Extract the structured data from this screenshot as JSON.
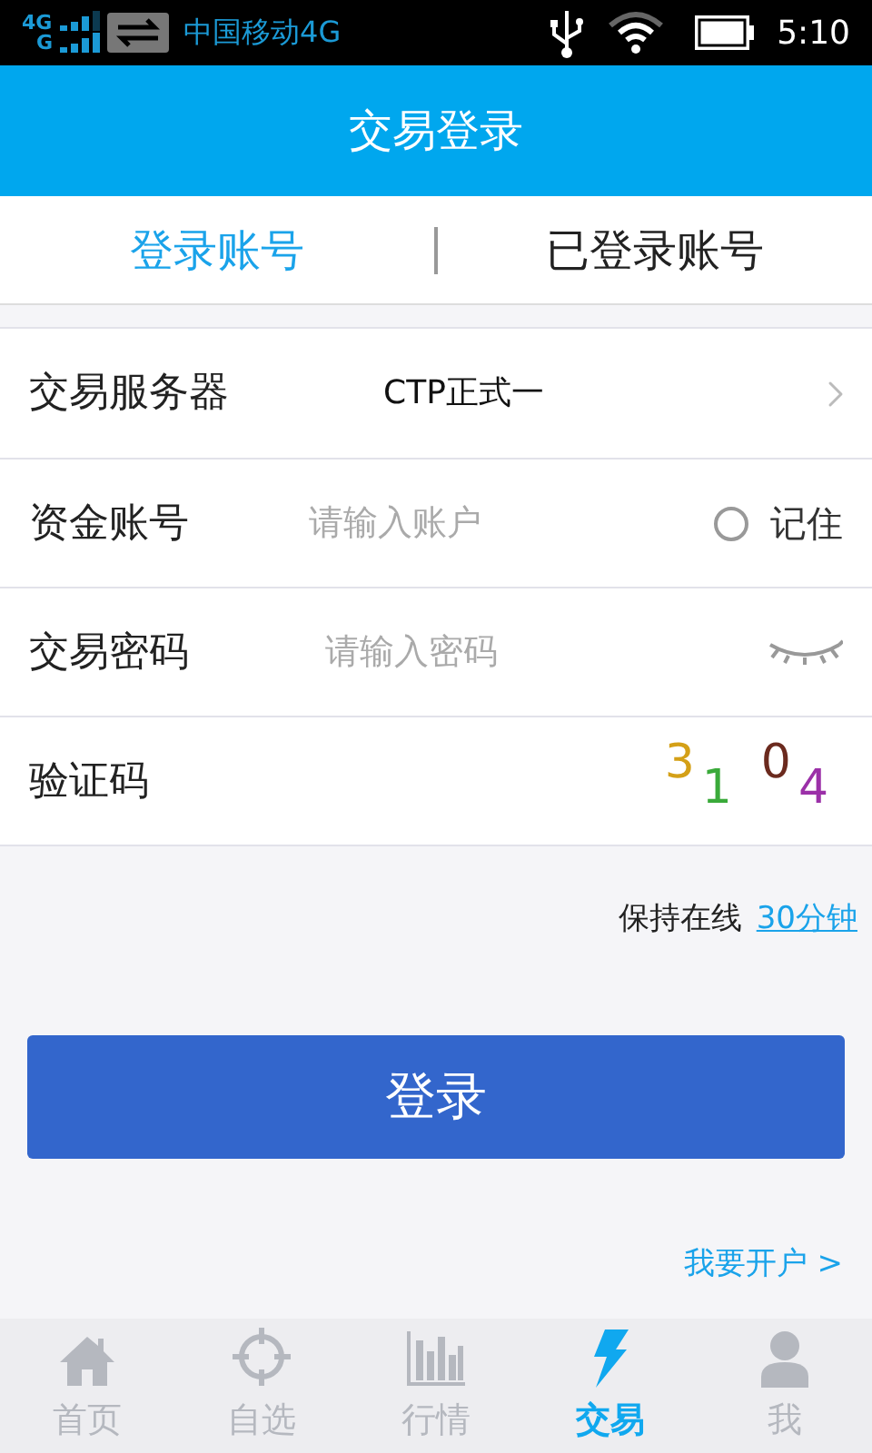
{
  "status_bar": {
    "network_top": "4G",
    "network_bottom": "G",
    "carrier": "中国移动4G",
    "time": "5:10"
  },
  "header": {
    "title": "交易登录"
  },
  "tabs": [
    {
      "label": "登录账号",
      "selected": true
    },
    {
      "label": "已登录账号",
      "selected": false
    }
  ],
  "form": [
    {
      "kind": "select",
      "label": "交易服务器",
      "value": "CTP正式一"
    },
    {
      "kind": "account",
      "label": "资金账号",
      "placeholder": "请输入账户",
      "remember": {
        "label": "记住",
        "checked": false
      }
    },
    {
      "kind": "password",
      "label": "交易密码",
      "placeholder": "请输入密码"
    },
    {
      "kind": "captcha",
      "label": "验证码",
      "digits": [
        {
          "text": "3",
          "color": "#d4a017"
        },
        {
          "text": "1",
          "color": "#3aaa3a"
        },
        {
          "text": "0",
          "color": "#6b2a1e"
        },
        {
          "text": "4",
          "color": "#9b30a8"
        }
      ]
    }
  ],
  "keep_online": {
    "label": "保持在线",
    "value": "30分钟"
  },
  "login_button": "登录",
  "open_account_link": "我要开户 >",
  "bottom_nav": [
    {
      "label": "首页",
      "selected": false
    },
    {
      "label": "自选",
      "selected": false
    },
    {
      "label": "行情",
      "selected": false
    },
    {
      "label": "交易",
      "selected": true
    },
    {
      "label": "我",
      "selected": false
    }
  ]
}
